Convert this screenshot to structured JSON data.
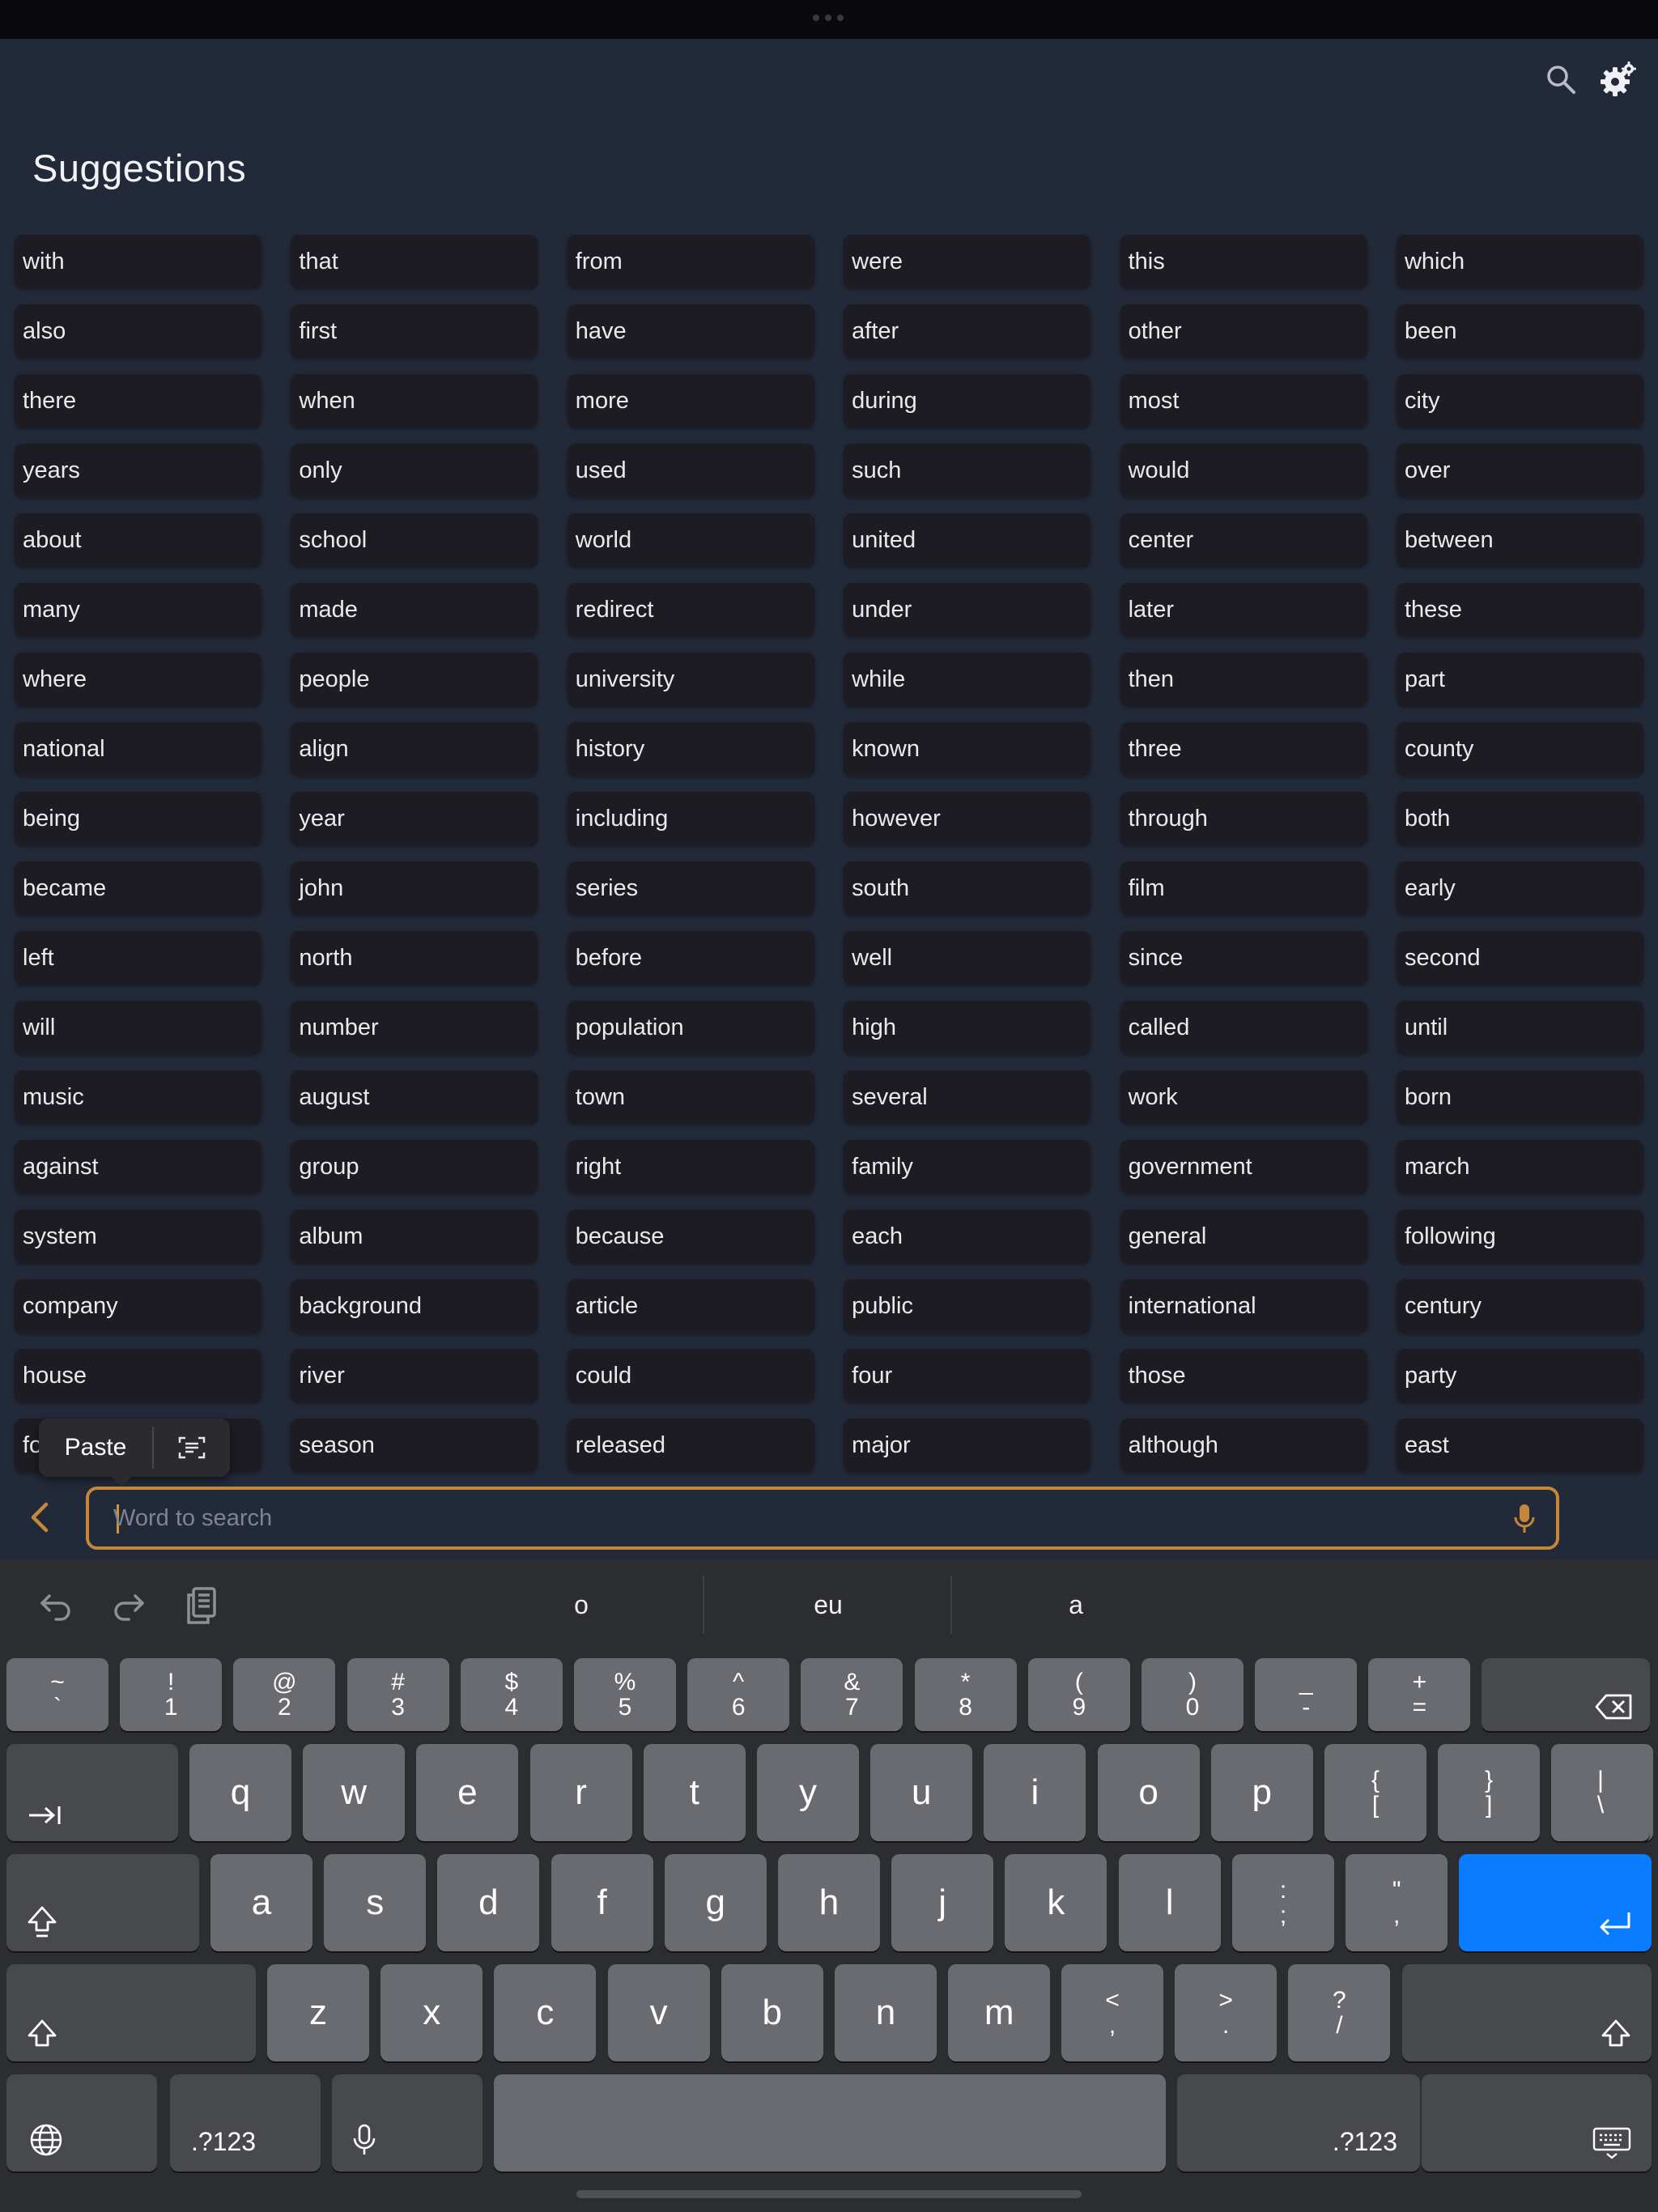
{
  "header": {
    "title": "Suggestions"
  },
  "words": [
    "with",
    "that",
    "from",
    "were",
    "this",
    "which",
    "also",
    "first",
    "have",
    "after",
    "other",
    "been",
    "there",
    "when",
    "more",
    "during",
    "most",
    "city",
    "years",
    "only",
    "used",
    "such",
    "would",
    "over",
    "about",
    "school",
    "world",
    "united",
    "center",
    "between",
    "many",
    "made",
    "redirect",
    "under",
    "later",
    "these",
    "where",
    "people",
    "university",
    "while",
    "then",
    "part",
    "national",
    "align",
    "history",
    "known",
    "three",
    "county",
    "being",
    "year",
    "including",
    "however",
    "through",
    "both",
    "became",
    "john",
    "series",
    "south",
    "film",
    "early",
    "left",
    "north",
    "before",
    "well",
    "since",
    "second",
    "will",
    "number",
    "population",
    "high",
    "called",
    "until",
    "music",
    "august",
    "town",
    "several",
    "work",
    "born",
    "against",
    "group",
    "right",
    "family",
    "government",
    "march",
    "system",
    "album",
    "because",
    "each",
    "general",
    "following",
    "company",
    "background",
    "article",
    "public",
    "international",
    "century",
    "house",
    "river",
    "could",
    "four",
    "those",
    "party",
    "fo",
    "season",
    "released",
    "major",
    "although",
    "east"
  ],
  "paste_menu": {
    "paste_label": "Paste"
  },
  "search": {
    "placeholder": "Word to search",
    "value": ""
  },
  "keyboard": {
    "suggestions": [
      "o",
      "eu",
      "a"
    ],
    "row1": [
      [
        "~",
        "`"
      ],
      [
        "!",
        "1"
      ],
      [
        "@",
        "2"
      ],
      [
        "#",
        "3"
      ],
      [
        "$",
        "4"
      ],
      [
        "%",
        "5"
      ],
      [
        "^",
        "6"
      ],
      [
        "&",
        "7"
      ],
      [
        "*",
        "8"
      ],
      [
        "(",
        "9"
      ],
      [
        ")",
        "0"
      ],
      [
        "_",
        "-"
      ],
      [
        "+",
        "="
      ]
    ],
    "row2": [
      "q",
      "w",
      "e",
      "r",
      "t",
      "y",
      "u",
      "i",
      "o",
      "p"
    ],
    "row2_sym": [
      [
        "{",
        "["
      ],
      [
        "}",
        "]"
      ],
      [
        "|",
        "\\"
      ]
    ],
    "row3": [
      "a",
      "s",
      "d",
      "f",
      "g",
      "h",
      "j",
      "k",
      "l"
    ],
    "row3_sym": [
      [
        ":",
        ";"
      ],
      [
        "\"",
        ","
      ]
    ],
    "row4": [
      "z",
      "x",
      "c",
      "v",
      "b",
      "n",
      "m"
    ],
    "row4_sym": [
      [
        "<",
        ","
      ],
      [
        ">",
        "."
      ],
      [
        "?",
        "/"
      ]
    ],
    "numbers_label": ".?123"
  },
  "colors": {
    "background": "#222939",
    "chip": "#1d1c22",
    "accent": "#c4873a",
    "return_key": "#0a7cff"
  }
}
